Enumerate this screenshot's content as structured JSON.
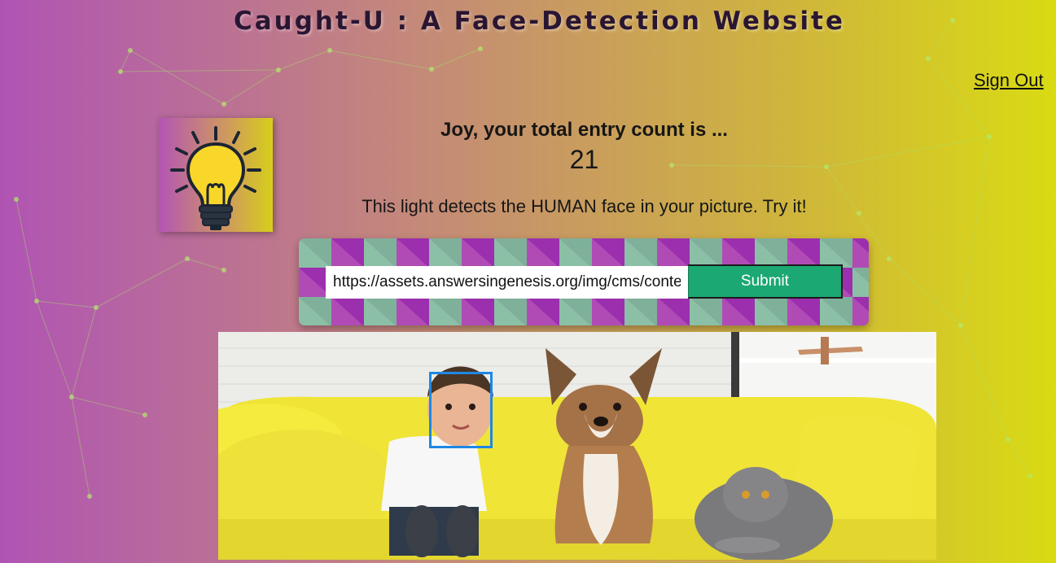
{
  "header": {
    "title": "Caught-U : A Face-Detection Website"
  },
  "nav": {
    "sign_out_label": "Sign Out"
  },
  "greeting": {
    "text": "Joy, your total entry count is ...",
    "count": "21"
  },
  "subtitle": "This light detects the HUMAN face in your picture. Try it!",
  "form": {
    "url_value": "https://assets.answersingenesis.org/img/cms/content/contentnode/header_image/children-with-pets.jpg",
    "submit_label": "Submit"
  },
  "result": {
    "detected_faces": 1
  },
  "icons": {
    "logo": "lightbulb-icon"
  },
  "colors": {
    "gradient_start": "#b054b4",
    "gradient_end": "#d9db13",
    "submit_button": "#1ca873",
    "face_box": "#1e88e5",
    "pattern_purple": "#9b2fae",
    "pattern_teal": "#7fb09a"
  }
}
